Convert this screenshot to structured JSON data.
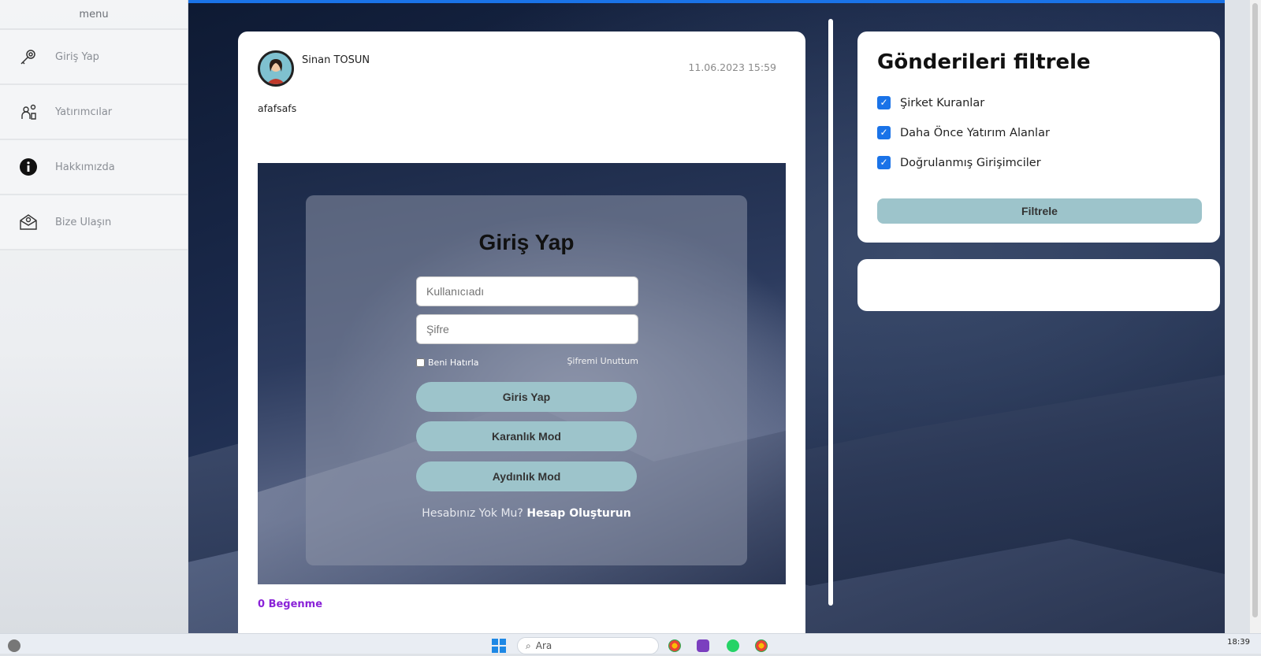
{
  "sidebar": {
    "menu_label": "menu",
    "items": [
      {
        "label": "Giriş Yap",
        "icon": "key-search-icon"
      },
      {
        "label": "Yatırımcılar",
        "icon": "investors-icon"
      },
      {
        "label": "Hakkımızda",
        "icon": "info-icon"
      },
      {
        "label": "Bize Ulaşın",
        "icon": "mail-contact-icon"
      }
    ]
  },
  "post": {
    "author": "Sinan TOSUN",
    "date": "11.06.2023 15:59",
    "text": "afafsafs",
    "likes": "0 Beğenme",
    "likes_color": "#8a22d8",
    "screenshot": {
      "title": "Giriş Yap",
      "username_placeholder": "Kullanıcıadı",
      "password_placeholder": "Şifre",
      "remember_label": "Beni Hatırla",
      "forgot_label": "Şifremi Unuttum",
      "buttons": [
        "Giris Yap",
        "Karanlık Mod",
        "Aydınlık Mod"
      ],
      "signup_prompt": "Hesabınız Yok Mu?",
      "signup_link": "Hesap Oluşturun"
    }
  },
  "filter": {
    "title": "Gönderileri filtrele",
    "options": [
      {
        "label": "Şirket Kuranlar",
        "checked": true
      },
      {
        "label": "Daha Önce Yatırım Alanlar",
        "checked": true
      },
      {
        "label": "Doğrulanmış Girişimciler",
        "checked": true
      }
    ],
    "button": "Filtrele",
    "accent": "#9dc4cb",
    "checkbox_color": "#1a73e8"
  },
  "taskbar": {
    "search_placeholder": "Ara",
    "time": "18:39"
  }
}
